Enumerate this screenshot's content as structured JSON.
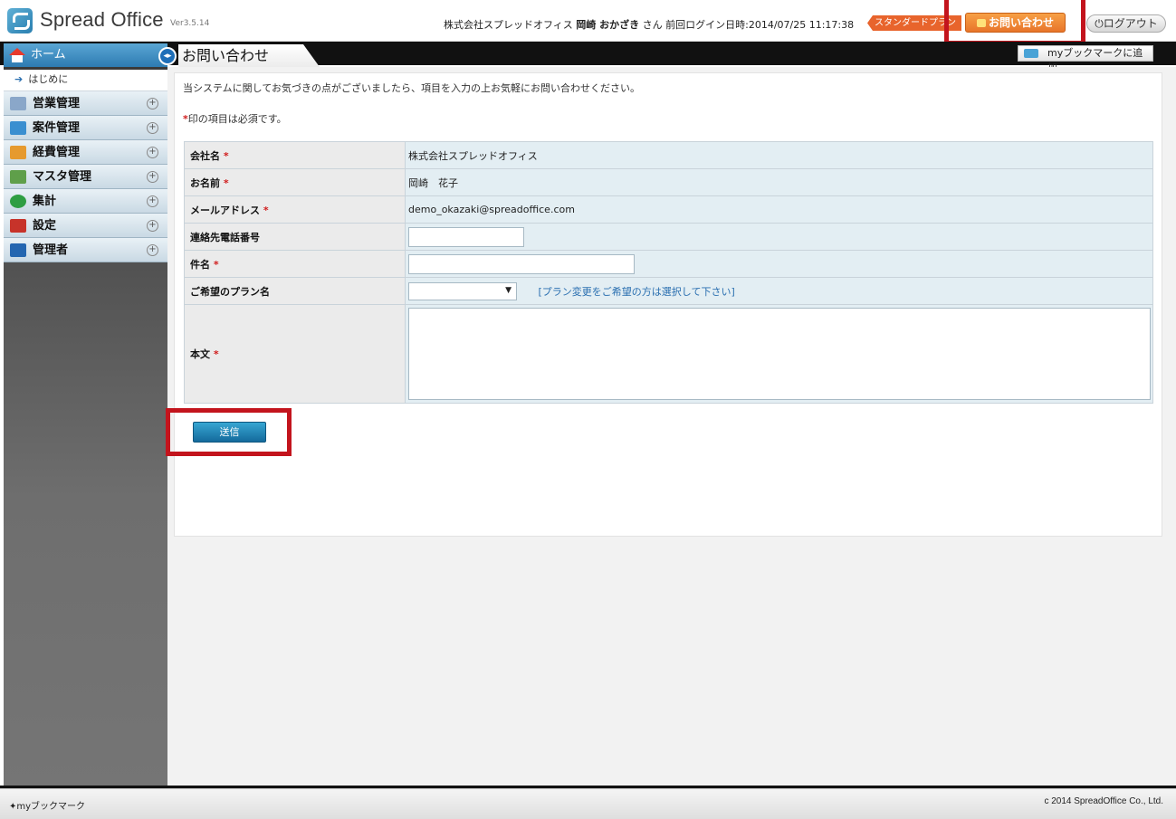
{
  "header": {
    "logo_text": "Spread Office",
    "version": "Ver3.5.14",
    "user_prefix": "株式会社スプレッドオフィス",
    "user_name": "岡崎 おかざき",
    "user_suffix": "さん",
    "last_login": "前回ログイン日時:2014/07/25 11:17:38",
    "plan_badge": "スタンダードプラン",
    "contact_label": "お問い合わせ",
    "logout_label": "ログアウト"
  },
  "sidebar": {
    "home_label": "ホーム",
    "sub_item": "はじめに",
    "items": [
      {
        "label": "営業管理",
        "icon": "sales-icon",
        "color": "#8aa7c9"
      },
      {
        "label": "案件管理",
        "icon": "project-icon",
        "color": "#3a8fd0"
      },
      {
        "label": "経費管理",
        "icon": "expense-icon",
        "color": "#e69a2e"
      },
      {
        "label": "マスタ管理",
        "icon": "master-icon",
        "color": "#5f9f4a"
      },
      {
        "label": "集計",
        "icon": "chart-icon",
        "color": "#2e9e42"
      },
      {
        "label": "設定",
        "icon": "settings-icon",
        "color": "#c7332a"
      },
      {
        "label": "管理者",
        "icon": "admin-icon",
        "color": "#2466b0"
      }
    ]
  },
  "page": {
    "tab_title": "お問い合わせ",
    "bookmark_add": "myブックマークに追加",
    "intro": "当システムに関してお気づきの点がございましたら、項目を入力の上お気軽にお問い合わせください。",
    "req_mark": "*",
    "req_note": "印の項目は必須です。"
  },
  "form": {
    "company_label": "会社名",
    "company_value": "株式会社スプレッドオフィス",
    "name_label": "お名前",
    "name_value": "岡崎　花子",
    "email_label": "メールアドレス",
    "email_value": "demo_okazaki@spreadoffice.com",
    "phone_label": "連絡先電話番号",
    "phone_value": "",
    "subject_label": "件名",
    "subject_value": "",
    "plan_label": "ご希望のプラン名",
    "plan_selected": "",
    "plan_hint": "[プラン変更をご希望の方は選択して下さい]",
    "body_label": "本文",
    "body_value": "",
    "submit_label": "送信"
  },
  "footer": {
    "bookmark_label": "myブックマーク",
    "copyright": "c 2014 SpreadOffice Co., Ltd."
  },
  "colors": {
    "accent": "#2d7bb2",
    "contact_orange": "#e8752a",
    "highlight_red": "#c3141d",
    "required_red": "#d01c1c"
  }
}
